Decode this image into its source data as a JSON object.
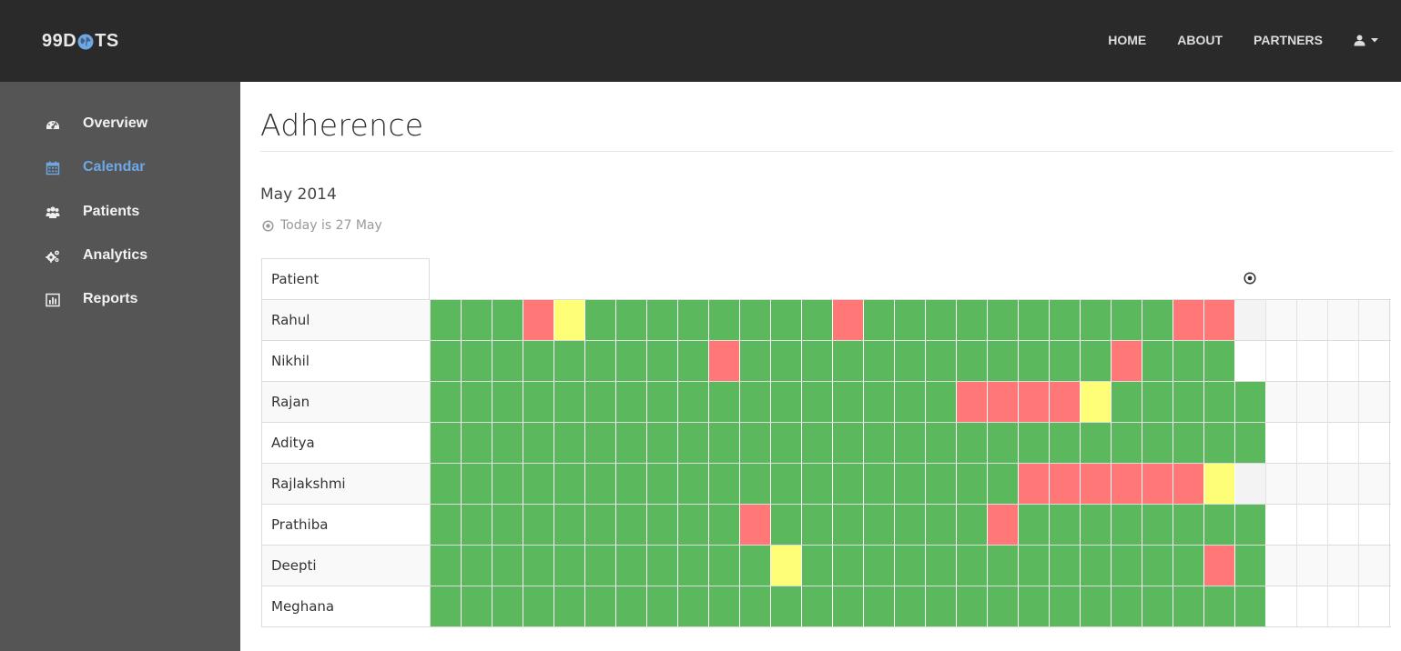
{
  "navbar": {
    "brand_pre": "99D",
    "brand_post": "TS",
    "links": [
      "HOME",
      "ABOUT",
      "PARTNERS"
    ],
    "user_icon": "user-icon",
    "user_caret": "caret-down-icon"
  },
  "sidebar": {
    "items": [
      {
        "label": "Overview",
        "icon": "dashboard-icon",
        "active": false
      },
      {
        "label": "Calendar",
        "icon": "calendar-icon",
        "active": true
      },
      {
        "label": "Patients",
        "icon": "users-icon",
        "active": false
      },
      {
        "label": "Analytics",
        "icon": "gears-icon",
        "active": false
      },
      {
        "label": "Reports",
        "icon": "bar-chart-icon",
        "active": false
      }
    ]
  },
  "main": {
    "title": "Adherence",
    "month": "May 2014",
    "today_text": "Today is 27 May",
    "patient_header": "Patient"
  },
  "colors": {
    "taken": "#5cb85c",
    "missed": "#ff7777",
    "partial": "#ffff77",
    "active_nav": "#6ea7e6"
  },
  "legend_codes": {
    "G": "taken",
    "R": "missed",
    "Y": "partial",
    "-": "no data (today)",
    ".": "future"
  },
  "patients": [
    {
      "name": "Rahul",
      "days": "GGGRYGGGGGGGGRGGGGGGGGGGRR-...."
    },
    {
      "name": "Nikhil",
      "days": "GGGGGGGGGRGGGGGGGGGGGGRGGG....."
    },
    {
      "name": "Rajan",
      "days": "GGGGGGGGGGGGGGGGGRRRRYGGGGG...."
    },
    {
      "name": "Aditya",
      "days": "GGGGGGGGGGGGGGGGGGGGGGGGGGG...."
    },
    {
      "name": "Rajlakshmi",
      "days": "GGGGGGGGGGGGGGGGGGGRRRRRRY-...."
    },
    {
      "name": "Prathiba",
      "days": "GGGGGGGGGGRGGGGGGGRGGGGGGGG...."
    },
    {
      "name": "Deepti",
      "days": "GGGGGGGGGGGYGGGGGGGGGGGGGRG...."
    },
    {
      "name": "Meghana",
      "days": "GGGGGGGGGGGGGGGGGGGGGGGGGGG...."
    }
  ]
}
